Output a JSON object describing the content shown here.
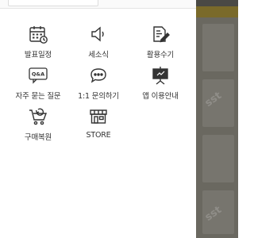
{
  "menu": {
    "items": [
      {
        "label": "발표일정",
        "icon": "calendar-icon"
      },
      {
        "label": "세소식",
        "icon": "megaphone-icon"
      },
      {
        "label": "활용수기",
        "icon": "pencil-note-icon"
      },
      {
        "label": "자주 묻는 질문",
        "icon": "qa-bubble-icon"
      },
      {
        "label": "1:1 문의하기",
        "icon": "chat-bubble-icon"
      },
      {
        "label": "앱 이용안내",
        "icon": "presentation-board-icon"
      },
      {
        "label": "구매복원",
        "icon": "shopping-cart-icon"
      },
      {
        "label": "STORE",
        "icon": "store-icon"
      }
    ]
  },
  "icon_text": {
    "qa": "Q&A"
  },
  "colors": {
    "icon_stroke": "#333333",
    "label_text": "#333333",
    "backdrop": "#6a6860",
    "accent_bar": "#7a6a2a"
  },
  "background": {
    "watermark": "sst"
  }
}
